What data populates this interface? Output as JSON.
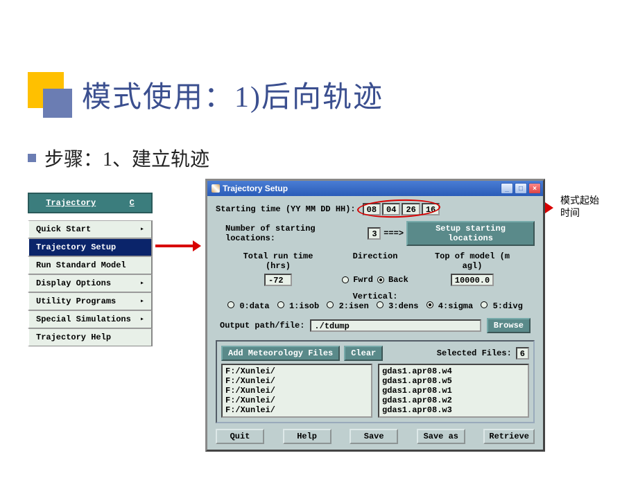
{
  "slide": {
    "title": "模式使用：1)后向轨迹",
    "bullet": "步骤：1、建立轨迹"
  },
  "menu": {
    "header_left": "Trajectory",
    "header_right_initial": "C",
    "items": [
      {
        "label": "Quick Start",
        "arrow": true
      },
      {
        "label": "Trajectory Setup",
        "arrow": false,
        "selected": true
      },
      {
        "label": "Run Standard Model",
        "arrow": false
      },
      {
        "label": "Display Options",
        "arrow": true
      },
      {
        "label": "Utility Programs",
        "arrow": true
      },
      {
        "label": "Special Simulations",
        "arrow": true
      },
      {
        "label": "Trajectory Help",
        "arrow": false
      }
    ]
  },
  "note": {
    "line1": "模式起始",
    "line2": "时间"
  },
  "dialog": {
    "title": "Trajectory Setup",
    "starting_time_label": "Starting time   (YY MM DD HH):",
    "start": {
      "yy": "08",
      "mm": "04",
      "dd": "26",
      "hh": "16"
    },
    "num_loc_label": "Number of starting locations:",
    "num_loc": "3",
    "arrow_chars": "===>",
    "setup_loc_btn": "Setup starting locations",
    "col1": "Total run time (hrs)",
    "col2": "Direction",
    "col3": "Top of model (m agl)",
    "total_run": "-72",
    "dir_fwrd": "Fwrd",
    "dir_back": "Back",
    "top_model": "10000.0",
    "vertical_label": "Vertical:",
    "vertical_opts": [
      "0:data",
      "1:isob",
      "2:isen",
      "3:dens",
      "4:sigma",
      "5:divg"
    ],
    "vertical_selected_index": 4,
    "output_label": "Output path/file:",
    "output_value": "./tdump",
    "browse": "Browse",
    "add_met": "Add Meteorology Files",
    "clear": "Clear",
    "selected_files_label": "Selected Files:",
    "selected_files_count": "6",
    "paths": [
      "F:/Xunlei/",
      "F:/Xunlei/",
      "F:/Xunlei/",
      "F:/Xunlei/",
      "F:/Xunlei/"
    ],
    "files": [
      "gdas1.apr08.w4",
      "gdas1.apr08.w5",
      "gdas1.apr08.w1",
      "gdas1.apr08.w2",
      "gdas1.apr08.w3"
    ],
    "buttons": {
      "quit": "Quit",
      "help": "Help",
      "save": "Save",
      "saveas": "Save as",
      "retrieve": "Retrieve"
    }
  }
}
